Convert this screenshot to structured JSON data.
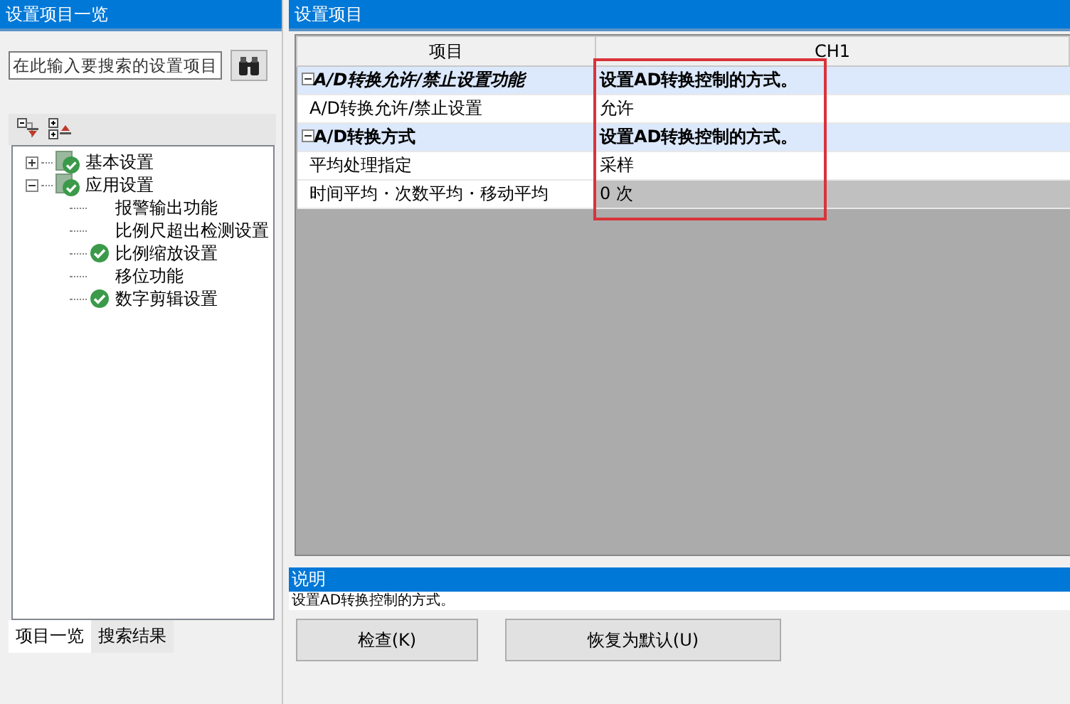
{
  "left_panel": {
    "title": "设置项目一览",
    "search": {
      "placeholder": "在此输入要搜索的设置项目"
    },
    "tree": [
      {
        "label": "基本设置",
        "expanded": false,
        "configured": true
      },
      {
        "label": "应用设置",
        "expanded": true,
        "configured": true,
        "children": [
          {
            "label": "报警输出功能",
            "configured": false
          },
          {
            "label": "比例尺超出检测设置",
            "configured": false
          },
          {
            "label": "比例缩放设置",
            "configured": true
          },
          {
            "label": "移位功能",
            "configured": false
          },
          {
            "label": "数字剪辑设置",
            "configured": true
          }
        ]
      }
    ],
    "tabs": [
      {
        "label": "项目一览",
        "selected": true
      },
      {
        "label": "搜索结果",
        "selected": false
      }
    ]
  },
  "right_panel": {
    "title": "设置项目",
    "columns": [
      "项目",
      "CH1"
    ],
    "rows": [
      {
        "kind": "group",
        "label": "A/D转换允许/禁止设置功能",
        "italic": true,
        "value": "设置AD转换控制的方式。",
        "expanded": true
      },
      {
        "kind": "item",
        "label": "A/D转换允许/禁止设置",
        "value": "允许",
        "disabled": false
      },
      {
        "kind": "group",
        "label": "A/D转换方式",
        "italic": false,
        "value": "设置AD转换控制的方式。",
        "expanded": true
      },
      {
        "kind": "item",
        "label": "平均处理指定",
        "value": "采样",
        "disabled": false
      },
      {
        "kind": "item",
        "label": "时间平均・次数平均・移动平均",
        "value": "0 次",
        "disabled": true
      }
    ],
    "description": {
      "title": "说明",
      "text": "设置AD转换控制的方式。"
    },
    "buttons": [
      "检查(K)",
      "恢复为默认(U)"
    ]
  }
}
